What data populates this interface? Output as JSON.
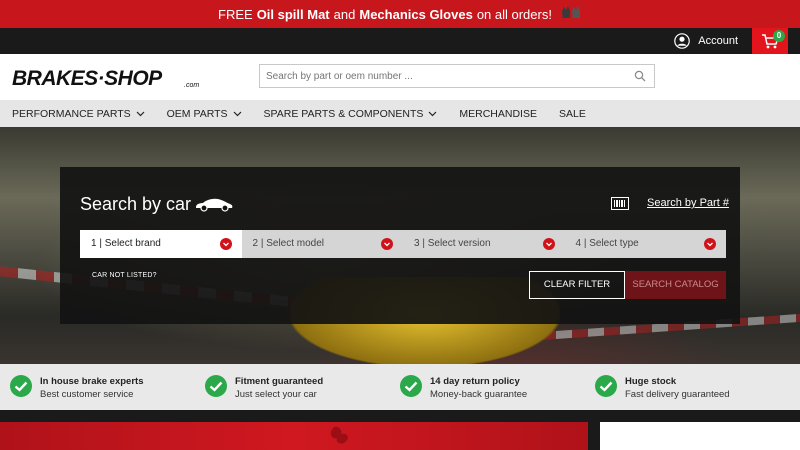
{
  "promo": {
    "prefix": "FREE",
    "item1": "Oil spill Mat",
    "and": "and",
    "item2": "Mechanics Gloves",
    "suffix": "on all orders!"
  },
  "topbar": {
    "account_label": "Account",
    "cart_count": "0"
  },
  "header": {
    "logo_text": "BRAKES·SHOP",
    "logo_suffix": ".com",
    "search_placeholder": "Search by part or oem number ..."
  },
  "nav": {
    "items": [
      {
        "label": "PERFORMANCE PARTS",
        "has_dropdown": true
      },
      {
        "label": "OEM PARTS",
        "has_dropdown": true
      },
      {
        "label": "SPARE PARTS & COMPONENTS",
        "has_dropdown": true
      },
      {
        "label": "MERCHANDISE",
        "has_dropdown": false
      },
      {
        "label": "SALE",
        "has_dropdown": false
      }
    ]
  },
  "search_panel": {
    "title": "Search by car",
    "part_link": "Search by Part #",
    "selects": [
      {
        "label": "1 | Select brand"
      },
      {
        "label": "2 | Select model"
      },
      {
        "label": "3 | Select version"
      },
      {
        "label": "4 | Select type"
      }
    ],
    "not_listed": "CAR NOT LISTED?",
    "clear_filter": "CLEAR FILTER",
    "search_catalog": "SEARCH CATALOG"
  },
  "usps": [
    {
      "title": "In house brake experts",
      "subtitle": "Best customer service"
    },
    {
      "title": "Fitment guaranteed",
      "subtitle": "Just select your car"
    },
    {
      "title": "14 day return policy",
      "subtitle": "Money-back guarantee"
    },
    {
      "title": "Huge stock",
      "subtitle": "Fast delivery guaranteed"
    }
  ],
  "colors": {
    "brand_red": "#c8161d",
    "check_green": "#2aa84a"
  }
}
